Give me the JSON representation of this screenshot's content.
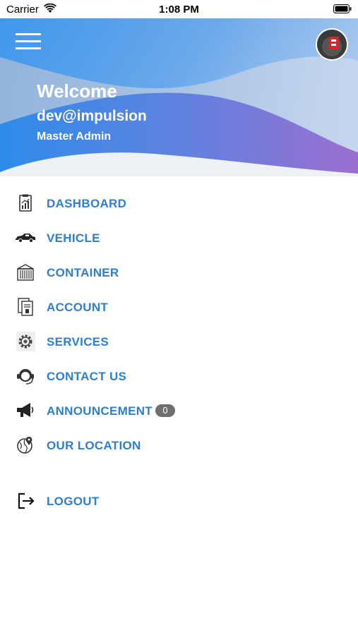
{
  "status_bar": {
    "carrier": "Carrier",
    "time": "1:08 PM"
  },
  "header": {
    "welcome": "Welcome",
    "username": "dev@impulsion",
    "role": "Master Admin"
  },
  "menu": {
    "items": [
      {
        "label": "DASHBOARD",
        "icon": "dashboard-clipboard-icon"
      },
      {
        "label": "VEHICLE",
        "icon": "car-icon"
      },
      {
        "label": "CONTAINER",
        "icon": "container-icon"
      },
      {
        "label": "ACCOUNT",
        "icon": "account-document-icon"
      },
      {
        "label": "SERVICES",
        "icon": "gear-icon"
      },
      {
        "label": "CONTACT US",
        "icon": "headset-icon"
      },
      {
        "label": "ANNOUNCEMENT",
        "icon": "megaphone-icon",
        "badge": "0"
      },
      {
        "label": "OUR LOCATION",
        "icon": "globe-pin-icon"
      }
    ],
    "logout": {
      "label": "LOGOUT",
      "icon": "logout-icon"
    }
  },
  "colors": {
    "accent": "#2d7fce",
    "header_blue": "#3a8fe8",
    "header_purple": "#8a6fd6",
    "badge": "#6f6f6f"
  }
}
